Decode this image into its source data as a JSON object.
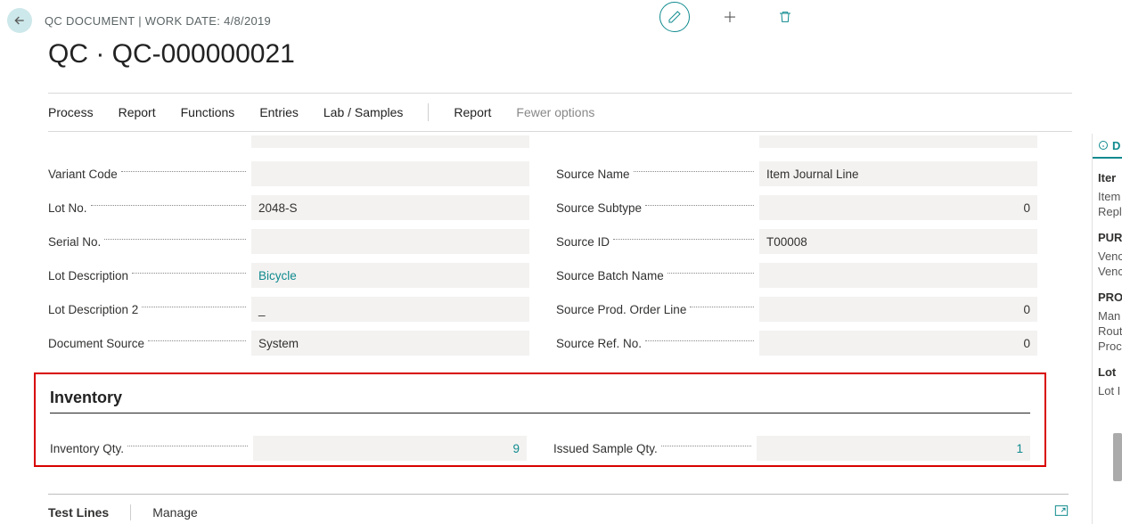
{
  "breadcrumb": "QC DOCUMENT | WORK DATE: 4/8/2019",
  "title": "QC · QC-000000021",
  "menu": {
    "process": "Process",
    "report": "Report",
    "functions": "Functions",
    "entries": "Entries",
    "lab": "Lab / Samples",
    "report2": "Report",
    "fewer": "Fewer options"
  },
  "fields_left": {
    "variant_code": {
      "label": "Variant Code",
      "value": ""
    },
    "lot_no": {
      "label": "Lot No.",
      "value": "2048-S"
    },
    "serial_no": {
      "label": "Serial No.",
      "value": ""
    },
    "lot_desc": {
      "label": "Lot Description",
      "value": "Bicycle"
    },
    "lot_desc2": {
      "label": "Lot Description 2",
      "value": "_"
    },
    "doc_source": {
      "label": "Document Source",
      "value": "System"
    }
  },
  "fields_right": {
    "source_name": {
      "label": "Source Name",
      "value": "Item Journal Line"
    },
    "source_subtype": {
      "label": "Source Subtype",
      "value": "0"
    },
    "source_id": {
      "label": "Source ID",
      "value": "T00008"
    },
    "source_batch": {
      "label": "Source Batch Name",
      "value": ""
    },
    "source_prod": {
      "label": "Source Prod. Order Line",
      "value": "0"
    },
    "source_ref": {
      "label": "Source Ref. No.",
      "value": "0"
    }
  },
  "inventory": {
    "title": "Inventory",
    "qty": {
      "label": "Inventory Qty.",
      "value": "9"
    },
    "sample": {
      "label": "Issued Sample Qty.",
      "value": "1"
    }
  },
  "testlines": {
    "title": "Test Lines",
    "manage": "Manage"
  },
  "right_panel": {
    "details": "D",
    "item": "Iter",
    "item_no": "Item",
    "replenishment": "Repl",
    "purch": "PUR",
    "vendor_no": "Venc",
    "vendor_item": "Venc",
    "prod": "PRO",
    "mfg": "Man",
    "routing": "Rout",
    "prodbom": "Proc",
    "lot": "Lot",
    "lotno": "Lot I"
  }
}
